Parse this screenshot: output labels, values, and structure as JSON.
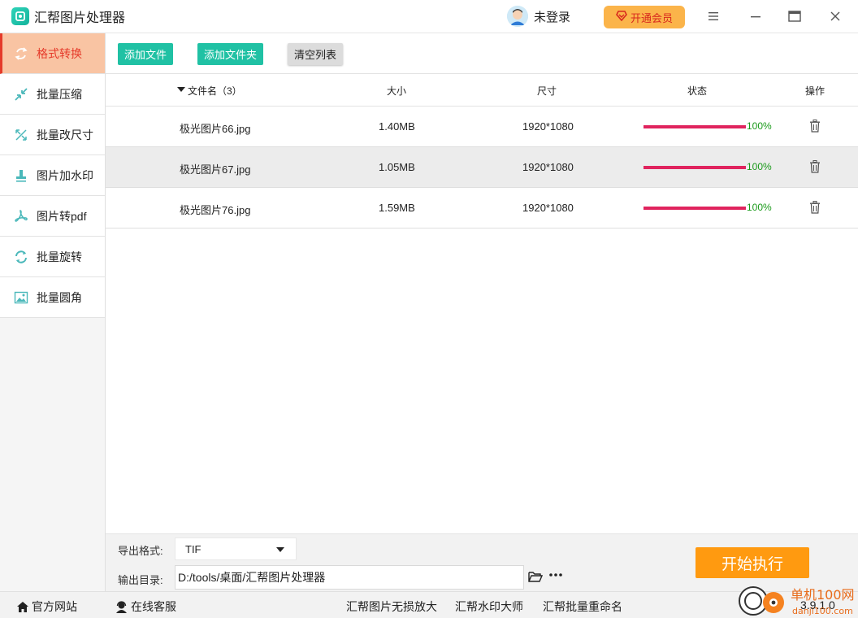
{
  "app": {
    "title": "汇帮图片处理器"
  },
  "header": {
    "user_name": "未登录",
    "vip_label": "开通会员",
    "window_buttons": [
      "menu-icon",
      "minimize-icon",
      "maximize-icon",
      "close-icon"
    ]
  },
  "sidebar": {
    "items": [
      {
        "label": "格式转换",
        "icon": "convert-icon",
        "active": true
      },
      {
        "label": "批量压缩",
        "icon": "compress-icon",
        "active": false
      },
      {
        "label": "批量改尺寸",
        "icon": "resize-icon",
        "active": false
      },
      {
        "label": "图片加水印",
        "icon": "watermark-icon",
        "active": false
      },
      {
        "label": "图片转pdf",
        "icon": "pdf-icon",
        "active": false
      },
      {
        "label": "批量旋转",
        "icon": "rotate-icon",
        "active": false
      },
      {
        "label": "批量圆角",
        "icon": "image-icon",
        "active": false
      }
    ]
  },
  "toolbar": {
    "add_file": "添加文件",
    "add_folder": "添加文件夹",
    "clear_list": "清空列表"
  },
  "table": {
    "headers": {
      "name": "文件名（3）",
      "size": "大小",
      "dimension": "尺寸",
      "status": "状态",
      "action": "操作"
    },
    "rows": [
      {
        "name": "极光图片66.jpg",
        "size": "1.40MB",
        "dimension": "1920*1080",
        "progress": "100%"
      },
      {
        "name": "极光图片67.jpg",
        "size": "1.05MB",
        "dimension": "1920*1080",
        "progress": "100%"
      },
      {
        "name": "极光图片76.jpg",
        "size": "1.59MB",
        "dimension": "1920*1080",
        "progress": "100%"
      }
    ]
  },
  "bottom": {
    "format_label": "导出格式:",
    "format_value": "TIF",
    "dir_label": "输出目录:",
    "dir_value": "D:/tools/桌面/汇帮图片处理器",
    "start_label": "开始执行"
  },
  "footer": {
    "official_site": "官方网站",
    "support": "在线客服",
    "link1": "汇帮图片无损放大",
    "link2": "汇帮水印大师",
    "link3": "汇帮批量重命名",
    "version": "3.9.1.0"
  },
  "colors": {
    "accent": "#20c1a4",
    "active_text": "#e53a2a",
    "progress": "#e0245e",
    "start": "#ff9a10",
    "vip": "#fbb44a"
  }
}
